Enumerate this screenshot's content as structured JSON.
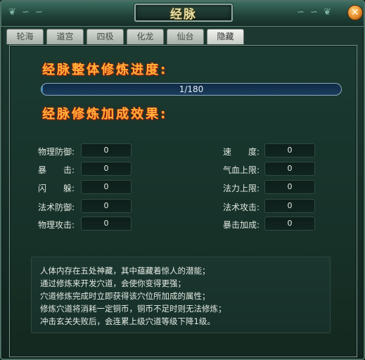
{
  "window": {
    "title": "经脉",
    "close_glyph": "✕"
  },
  "tabs": [
    {
      "label": "轮海",
      "active": false
    },
    {
      "label": "道宫",
      "active": false
    },
    {
      "label": "四极",
      "active": false
    },
    {
      "label": "化龙",
      "active": false
    },
    {
      "label": "仙台",
      "active": false
    },
    {
      "label": "隐藏",
      "active": true
    }
  ],
  "progress": {
    "heading": "经脉整体修炼进度:",
    "text": "1/180",
    "current": 1,
    "total": 180
  },
  "bonus": {
    "heading": "经脉修炼加成效果:",
    "left": [
      {
        "label": "物理防御:",
        "value": "0"
      },
      {
        "label": "暴　　击:",
        "value": "0"
      },
      {
        "label": "闪　　躲:",
        "value": "0"
      },
      {
        "label": "法术防御:",
        "value": "0"
      },
      {
        "label": "物理攻击:",
        "value": "0"
      }
    ],
    "right": [
      {
        "label": "速　　度:",
        "value": "0"
      },
      {
        "label": "气血上限:",
        "value": "0"
      },
      {
        "label": "法力上限:",
        "value": "0"
      },
      {
        "label": "法术攻击:",
        "value": "0"
      },
      {
        "label": "暴击加成:",
        "value": "0"
      }
    ]
  },
  "info": {
    "lines": [
      "人体内存在五处神藏，其中蕴藏着惊人的潜能；",
      "通过修炼来开发穴道，会使你变得更强；",
      "穴道修炼完成时立即获得该穴位所加成的属性；",
      "修炼穴道将消耗一定铜币，铜币不足时则无法修炼；",
      "冲击玄关失败后，会连累上级穴道等级下降1级。"
    ]
  },
  "colors": {
    "heading": "#ffb13a",
    "panel_bg": "#1a3a31",
    "progress_track": "#0f2a44",
    "progress_fill": "#4fa6d8"
  }
}
